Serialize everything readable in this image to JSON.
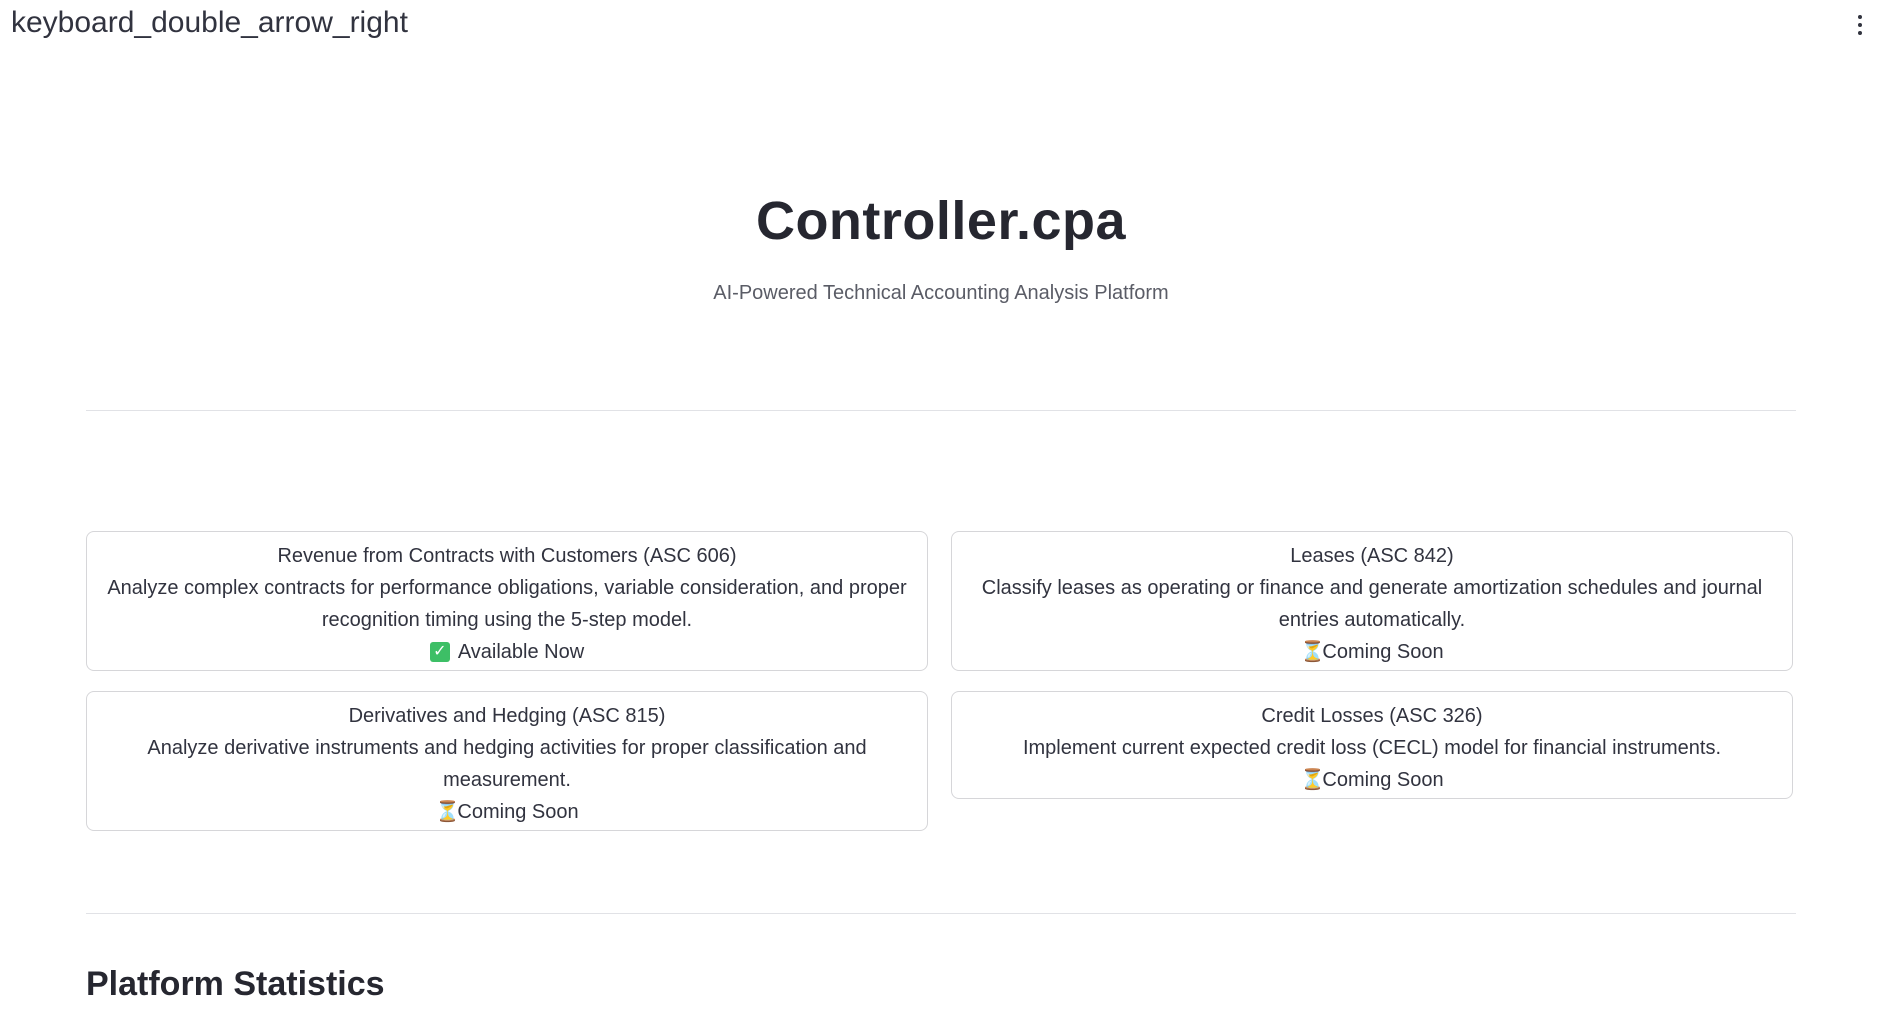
{
  "topbar": {
    "sidebar_toggle_label": "keyboard_double_arrow_right"
  },
  "hero": {
    "title": "Controller.cpa",
    "subtitle": "AI-Powered Technical Accounting Analysis Platform"
  },
  "cards": [
    {
      "title": "Revenue from Contracts with Customers (ASC 606)",
      "description": "Analyze complex contracts for performance obligations, variable consideration, and proper recognition timing using the 5-step model.",
      "status_icon": "check-icon",
      "status": "Available Now"
    },
    {
      "title": "Leases (ASC 842)",
      "description": "Classify leases as operating or finance and generate amortization schedules and journal entries automatically.",
      "status_icon": "hourglass-icon",
      "status": "Coming Soon"
    },
    {
      "title": "Derivatives and Hedging (ASC 815)",
      "description": "Analyze derivative instruments and hedging activities for proper classification and measurement.",
      "status_icon": "hourglass-icon",
      "status": "Coming Soon"
    },
    {
      "title": "Credit Losses (ASC 326)",
      "description": "Implement current expected credit loss (CECL) model for financial instruments.",
      "status_icon": "hourglass-icon",
      "status": "Coming Soon"
    }
  ],
  "statistics": {
    "heading": "Platform Statistics"
  },
  "colors": {
    "text": "#31333f",
    "check_green": "#3dbf66",
    "border": "#d6d6d9"
  }
}
